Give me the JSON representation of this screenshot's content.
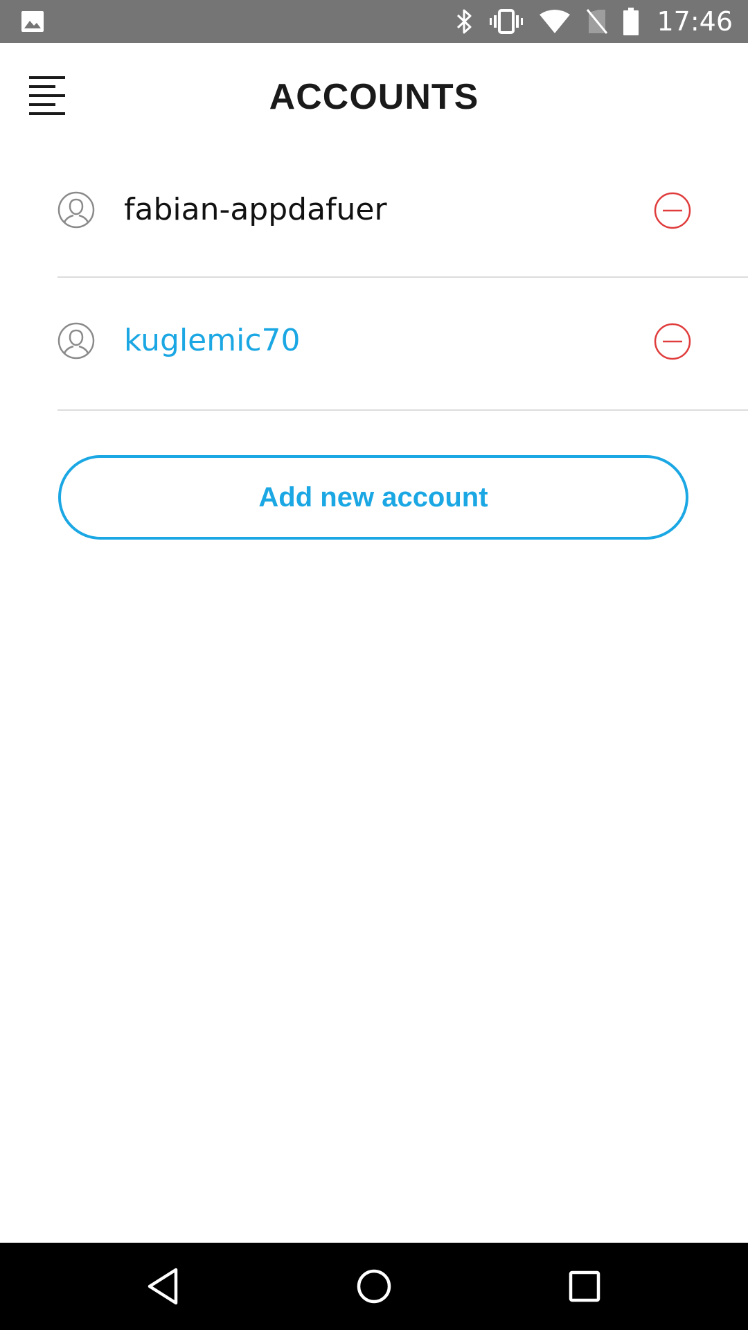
{
  "status_bar": {
    "time": "17:46",
    "icons": [
      "gallery-icon",
      "bluetooth-icon",
      "vibrate-icon",
      "wifi-icon",
      "no-sim-icon",
      "battery-icon"
    ],
    "background": "#757575"
  },
  "header": {
    "title": "ACCOUNTS",
    "menu_icon": "menu-icon"
  },
  "accounts": [
    {
      "name": "fabian-appdafuer",
      "active": false,
      "avatar_icon": "user-avatar-icon",
      "remove_icon": "remove-circle-icon"
    },
    {
      "name": "kuglemic70",
      "active": true,
      "avatar_icon": "user-avatar-icon",
      "remove_icon": "remove-circle-icon"
    }
  ],
  "add_account": {
    "label": "Add new account"
  },
  "nav_bar": {
    "buttons": [
      "back-icon",
      "home-icon",
      "recents-icon"
    ]
  },
  "colors": {
    "accent": "#1aa7e3",
    "remove": "#e03c3c",
    "text": "#111111",
    "divider": "#dcdcdc"
  }
}
